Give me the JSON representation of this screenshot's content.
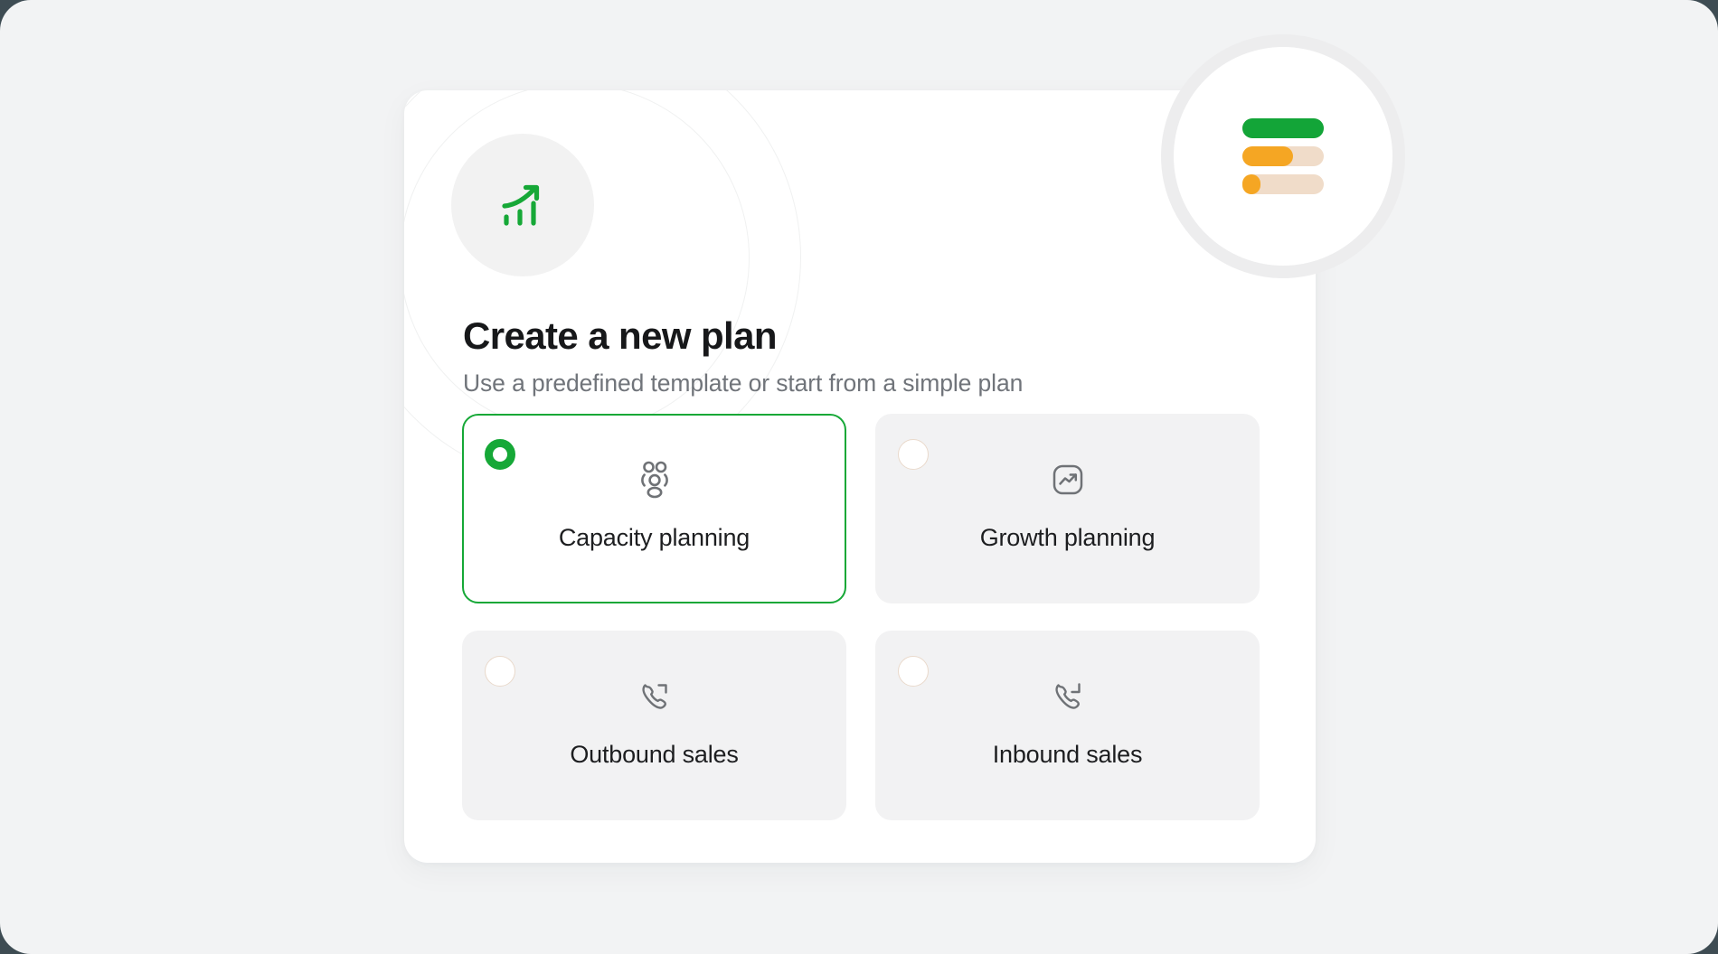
{
  "colors": {
    "page_background": "#f2f3f4",
    "panel_background": "#ffffff",
    "accent_green": "#16a837",
    "brand_green": "#13a538",
    "brand_orange": "#f5a623",
    "brand_track": "#f0dcc9",
    "card_background": "#f2f2f3",
    "radio_border": "#e9d9cb",
    "title_color": "#17181a",
    "subtitle_color": "#70747a",
    "icon_gray": "#6f7276"
  },
  "header": {
    "glyph_icon": "growth-chart-icon",
    "title": "Create a new plan",
    "subtitle": "Use a predefined template or start from a simple plan"
  },
  "brand_badge": {
    "icon": "stacked-progress-bars-logo",
    "bars": [
      {
        "name": "bar-green-full",
        "color": "#13a538",
        "fill_percent": 100
      },
      {
        "name": "bar-orange-partial",
        "color": "#f5a623",
        "fill_percent": 62
      },
      {
        "name": "bar-orange-small",
        "color": "#f5a623",
        "fill_percent": 22
      }
    ]
  },
  "options": [
    {
      "id": "capacity-planning",
      "label": "Capacity planning",
      "icon": "users-group-icon",
      "selected": true
    },
    {
      "id": "growth-planning",
      "label": "Growth planning",
      "icon": "trending-up-square-icon",
      "selected": false
    },
    {
      "id": "outbound-sales",
      "label": "Outbound sales",
      "icon": "phone-outgoing-icon",
      "selected": false
    },
    {
      "id": "inbound-sales",
      "label": "Inbound sales",
      "icon": "phone-incoming-icon",
      "selected": false
    }
  ]
}
